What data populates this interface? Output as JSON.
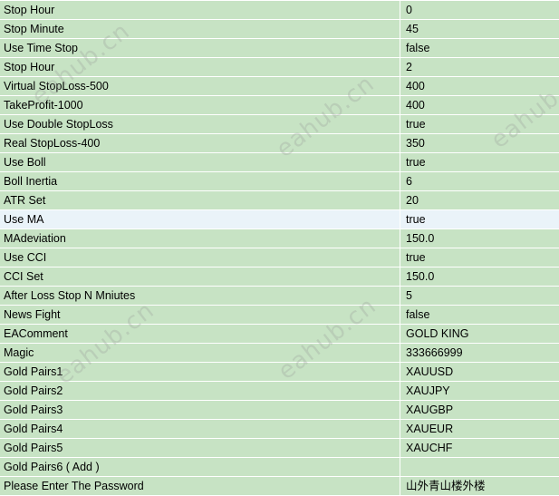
{
  "properties": [
    {
      "name": "Stop Hour",
      "value": "0"
    },
    {
      "name": "Stop Minute",
      "value": "45"
    },
    {
      "name": "Use Time Stop",
      "value": "false"
    },
    {
      "name": "Stop Hour",
      "value": "2"
    },
    {
      "name": "Virtual StopLoss-500",
      "value": "400"
    },
    {
      "name": "TakeProfit-1000",
      "value": "400"
    },
    {
      "name": "Use Double StopLoss",
      "value": "true"
    },
    {
      "name": "Real StopLoss-400",
      "value": "350"
    },
    {
      "name": "Use Boll",
      "value": "true"
    },
    {
      "name": "Boll Inertia",
      "value": "6"
    },
    {
      "name": "ATR Set",
      "value": "20"
    },
    {
      "name": "Use MA",
      "value": "true"
    },
    {
      "name": "MAdeviation",
      "value": "150.0"
    },
    {
      "name": "Use CCI",
      "value": "true"
    },
    {
      "name": "CCI Set",
      "value": "150.0"
    },
    {
      "name": "After Loss Stop N Mniutes",
      "value": "5"
    },
    {
      "name": "News Fight",
      "value": "false"
    },
    {
      "name": "EAComment",
      "value": "GOLD KING"
    },
    {
      "name": "Magic",
      "value": "333666999"
    },
    {
      "name": "Gold Pairs1",
      "value": "XAUUSD"
    },
    {
      "name": "Gold Pairs2",
      "value": "XAUJPY"
    },
    {
      "name": "Gold Pairs3",
      "value": "XAUGBP"
    },
    {
      "name": "Gold Pairs4",
      "value": "XAUEUR"
    },
    {
      "name": "Gold Pairs5",
      "value": "XAUCHF"
    },
    {
      "name": "Gold Pairs6 ( Add )",
      "value": ""
    },
    {
      "name": "Please Enter The Password",
      "value": "山外青山楼外楼"
    }
  ],
  "selected_row": "Use MA",
  "watermarks": [
    "eahub.cn",
    "eahub.cn",
    "eahub.cn",
    "eahub.cn",
    "eahub.cn"
  ],
  "colors": {
    "row_background": "#c7e3c4",
    "selected_row_background": "#eaf3f9",
    "grid_lines": "#ffffff"
  }
}
